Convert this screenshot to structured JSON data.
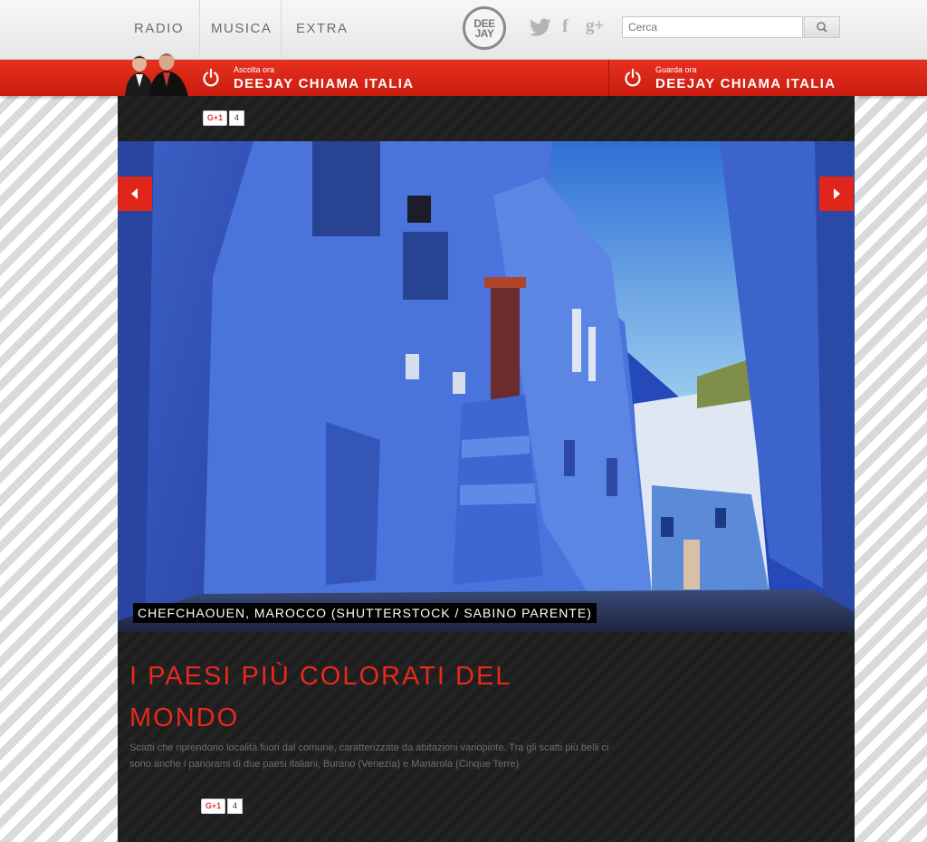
{
  "nav": {
    "items": [
      "RADIO",
      "MUSICA",
      "EXTRA"
    ],
    "logo_text": "DEE JAY"
  },
  "social": {
    "twitter_icon": "twitter-icon",
    "facebook_icon": "facebook-icon",
    "googleplus_icon": "googleplus-icon",
    "facebook_glyph": "f",
    "googleplus_glyph": "g+"
  },
  "search": {
    "placeholder": "Cerca",
    "button_icon": "magnifier-icon"
  },
  "live_bar": {
    "listen": {
      "kicker": "Ascolta ora",
      "title": "DEEJAY CHIAMA ITALIA"
    },
    "watch": {
      "kicker": "Guarda ora",
      "title": "DEEJAY CHIAMA ITALIA"
    }
  },
  "share": {
    "top": {
      "button_label": "G+1",
      "count": "4"
    },
    "bottom": {
      "button_label": "G+1",
      "count": "4"
    }
  },
  "gallery": {
    "caption": "CHEFCHAOUEN, MAROCCO (SHUTTERSTOCK / SABINO PARENTE)",
    "prev_icon": "chevron-left-icon",
    "next_icon": "chevron-right-icon"
  },
  "article": {
    "title": "I PAESI PIÙ COLORATI DEL MONDO",
    "description": "Scatti che riprendono località fuori dal comune, caratterizzate da abitazioni variopinte. Tra gli scatti più belli ci sono anche i panorami di due paesi italiani, Burano (Venezia) e Manarola (Cinque Terre)"
  },
  "colors": {
    "accent_red": "#e6291c",
    "bar_red": "#d9281a",
    "content_bg": "#1e1e1e",
    "caption_bg": "#000000"
  }
}
